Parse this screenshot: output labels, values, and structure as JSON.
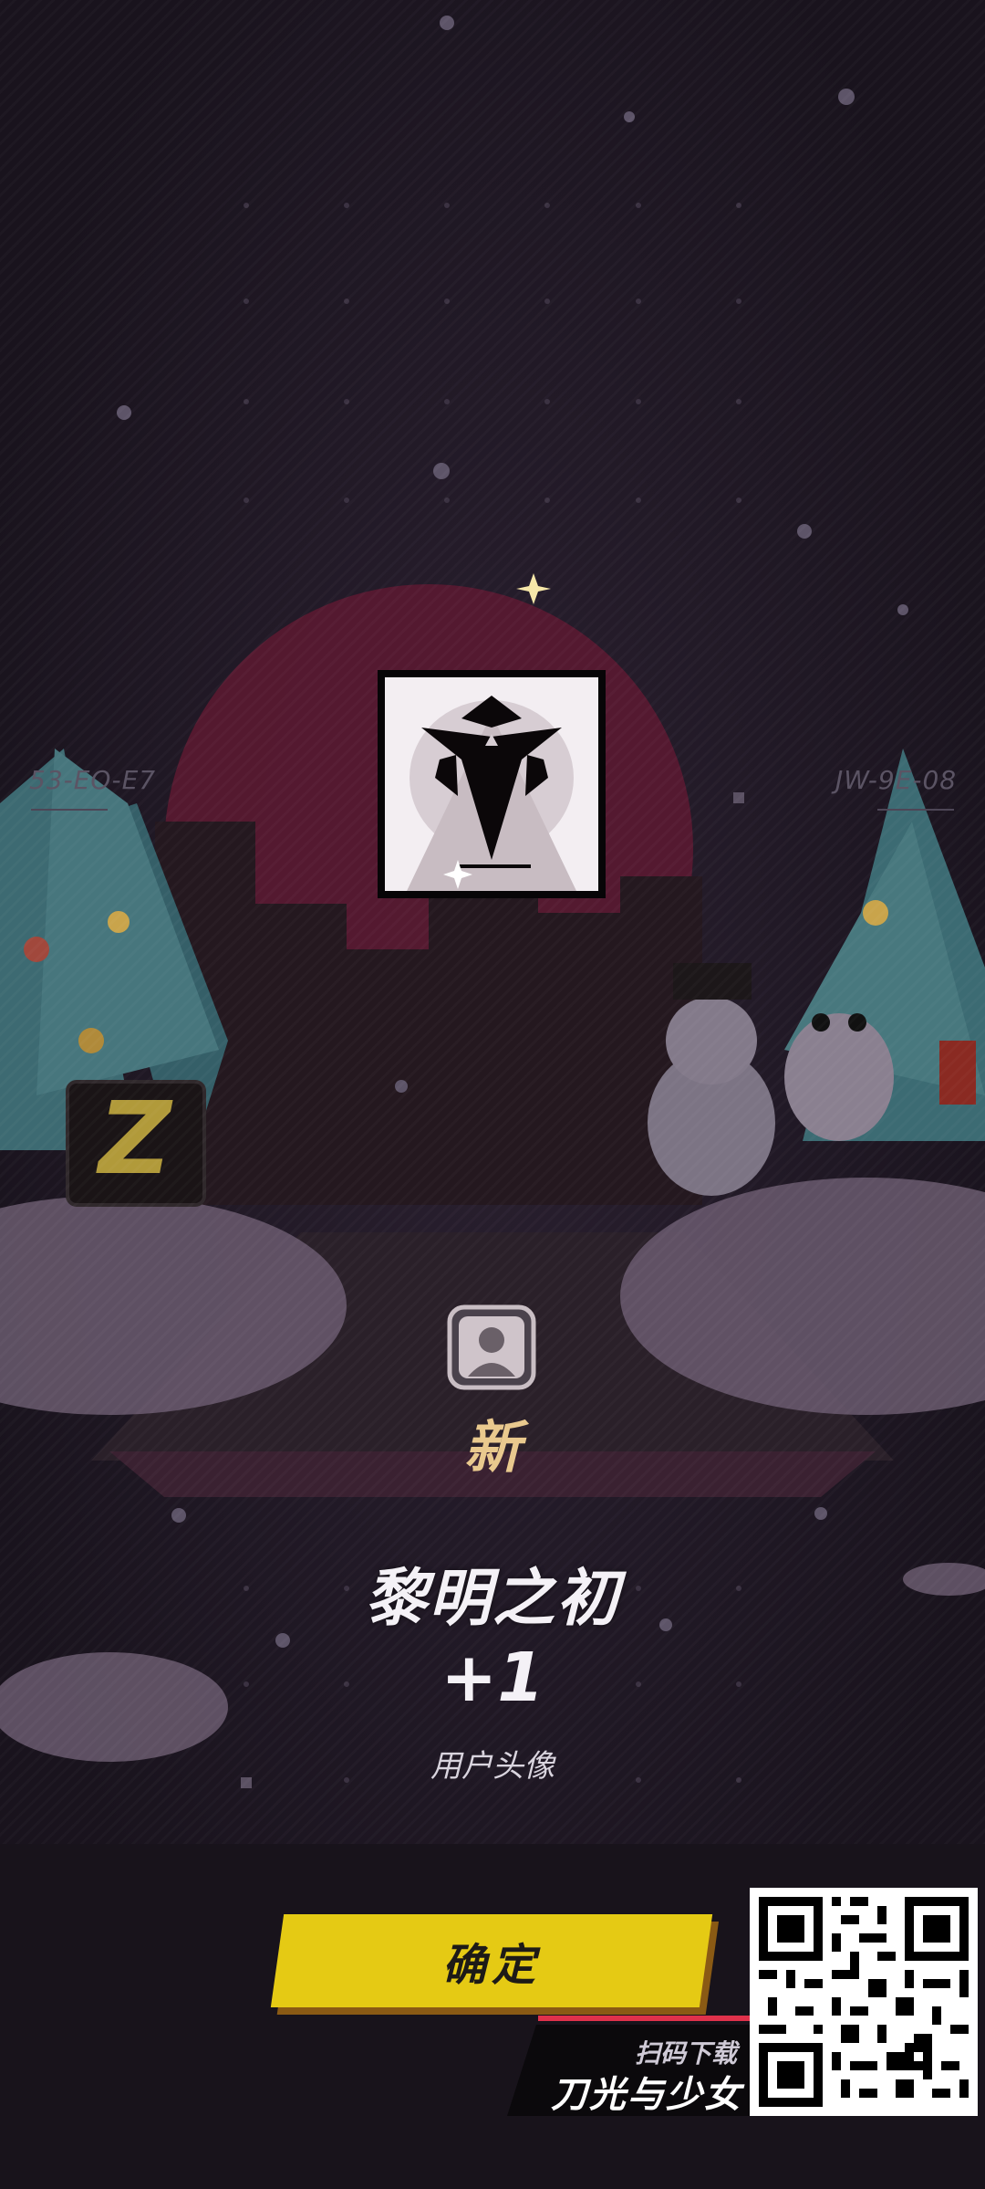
{
  "scene": {
    "left_code": "53-EO-E7",
    "right_code": "JW-9E-08",
    "colors": {
      "background": "#1c1622",
      "moon": "#6a1f38",
      "accent_gold": "#e9c98e",
      "button_yellow": "#e5ca14",
      "promo_red": "#e0314b"
    }
  },
  "reward": {
    "avatar_icon": "dawn-avatar-icon",
    "new_label": "新",
    "item_name": "黎明之初",
    "item_count": "+1",
    "item_type": "用户头像"
  },
  "actions": {
    "confirm_label": "确定"
  },
  "promo": {
    "line1": "扫码下载",
    "line2": "刀光与少女",
    "qr_icon": "qr-code-icon"
  }
}
